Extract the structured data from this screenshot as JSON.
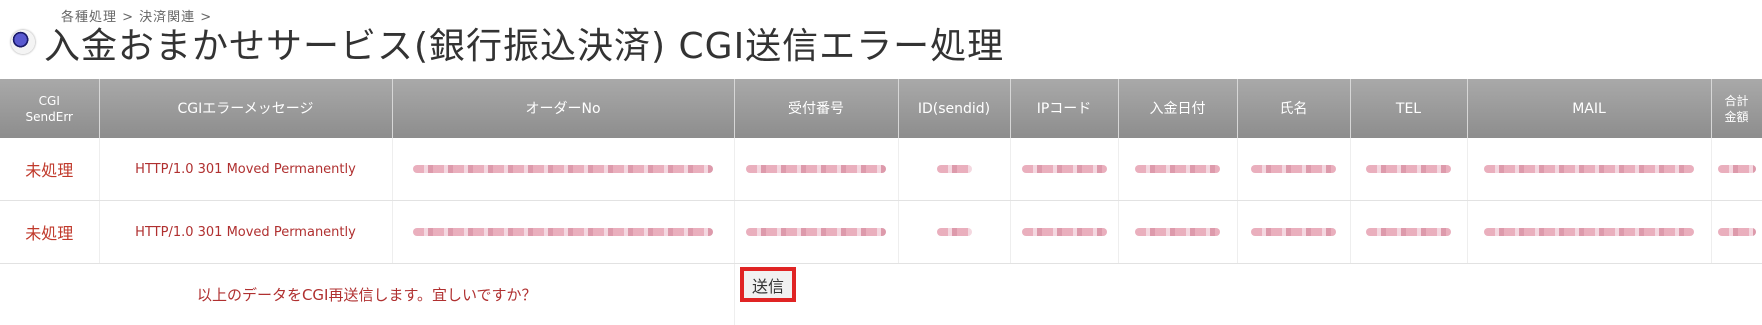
{
  "breadcrumb": "各種処理 > 決済関連 >",
  "title": "入金おまかせサービス(銀行振込決済) CGI送信エラー処理",
  "table": {
    "headers": [
      "CGI\nSendErr",
      "CGIエラーメッセージ",
      "オーダーNo",
      "受付番号",
      "ID(sendid)",
      "IPコード",
      "入金日付",
      "氏名",
      "TEL",
      "MAIL",
      "合計\n金額"
    ],
    "rows": [
      {
        "status": "未処理",
        "message": "HTTP/1.0 301 Moved Permanently"
      },
      {
        "status": "未処理",
        "message": "HTTP/1.0 301 Moved Permanently"
      }
    ]
  },
  "confirm": {
    "text": "以上のデータをCGI再送信します。宜しいですか？",
    "button_label": "送信"
  }
}
